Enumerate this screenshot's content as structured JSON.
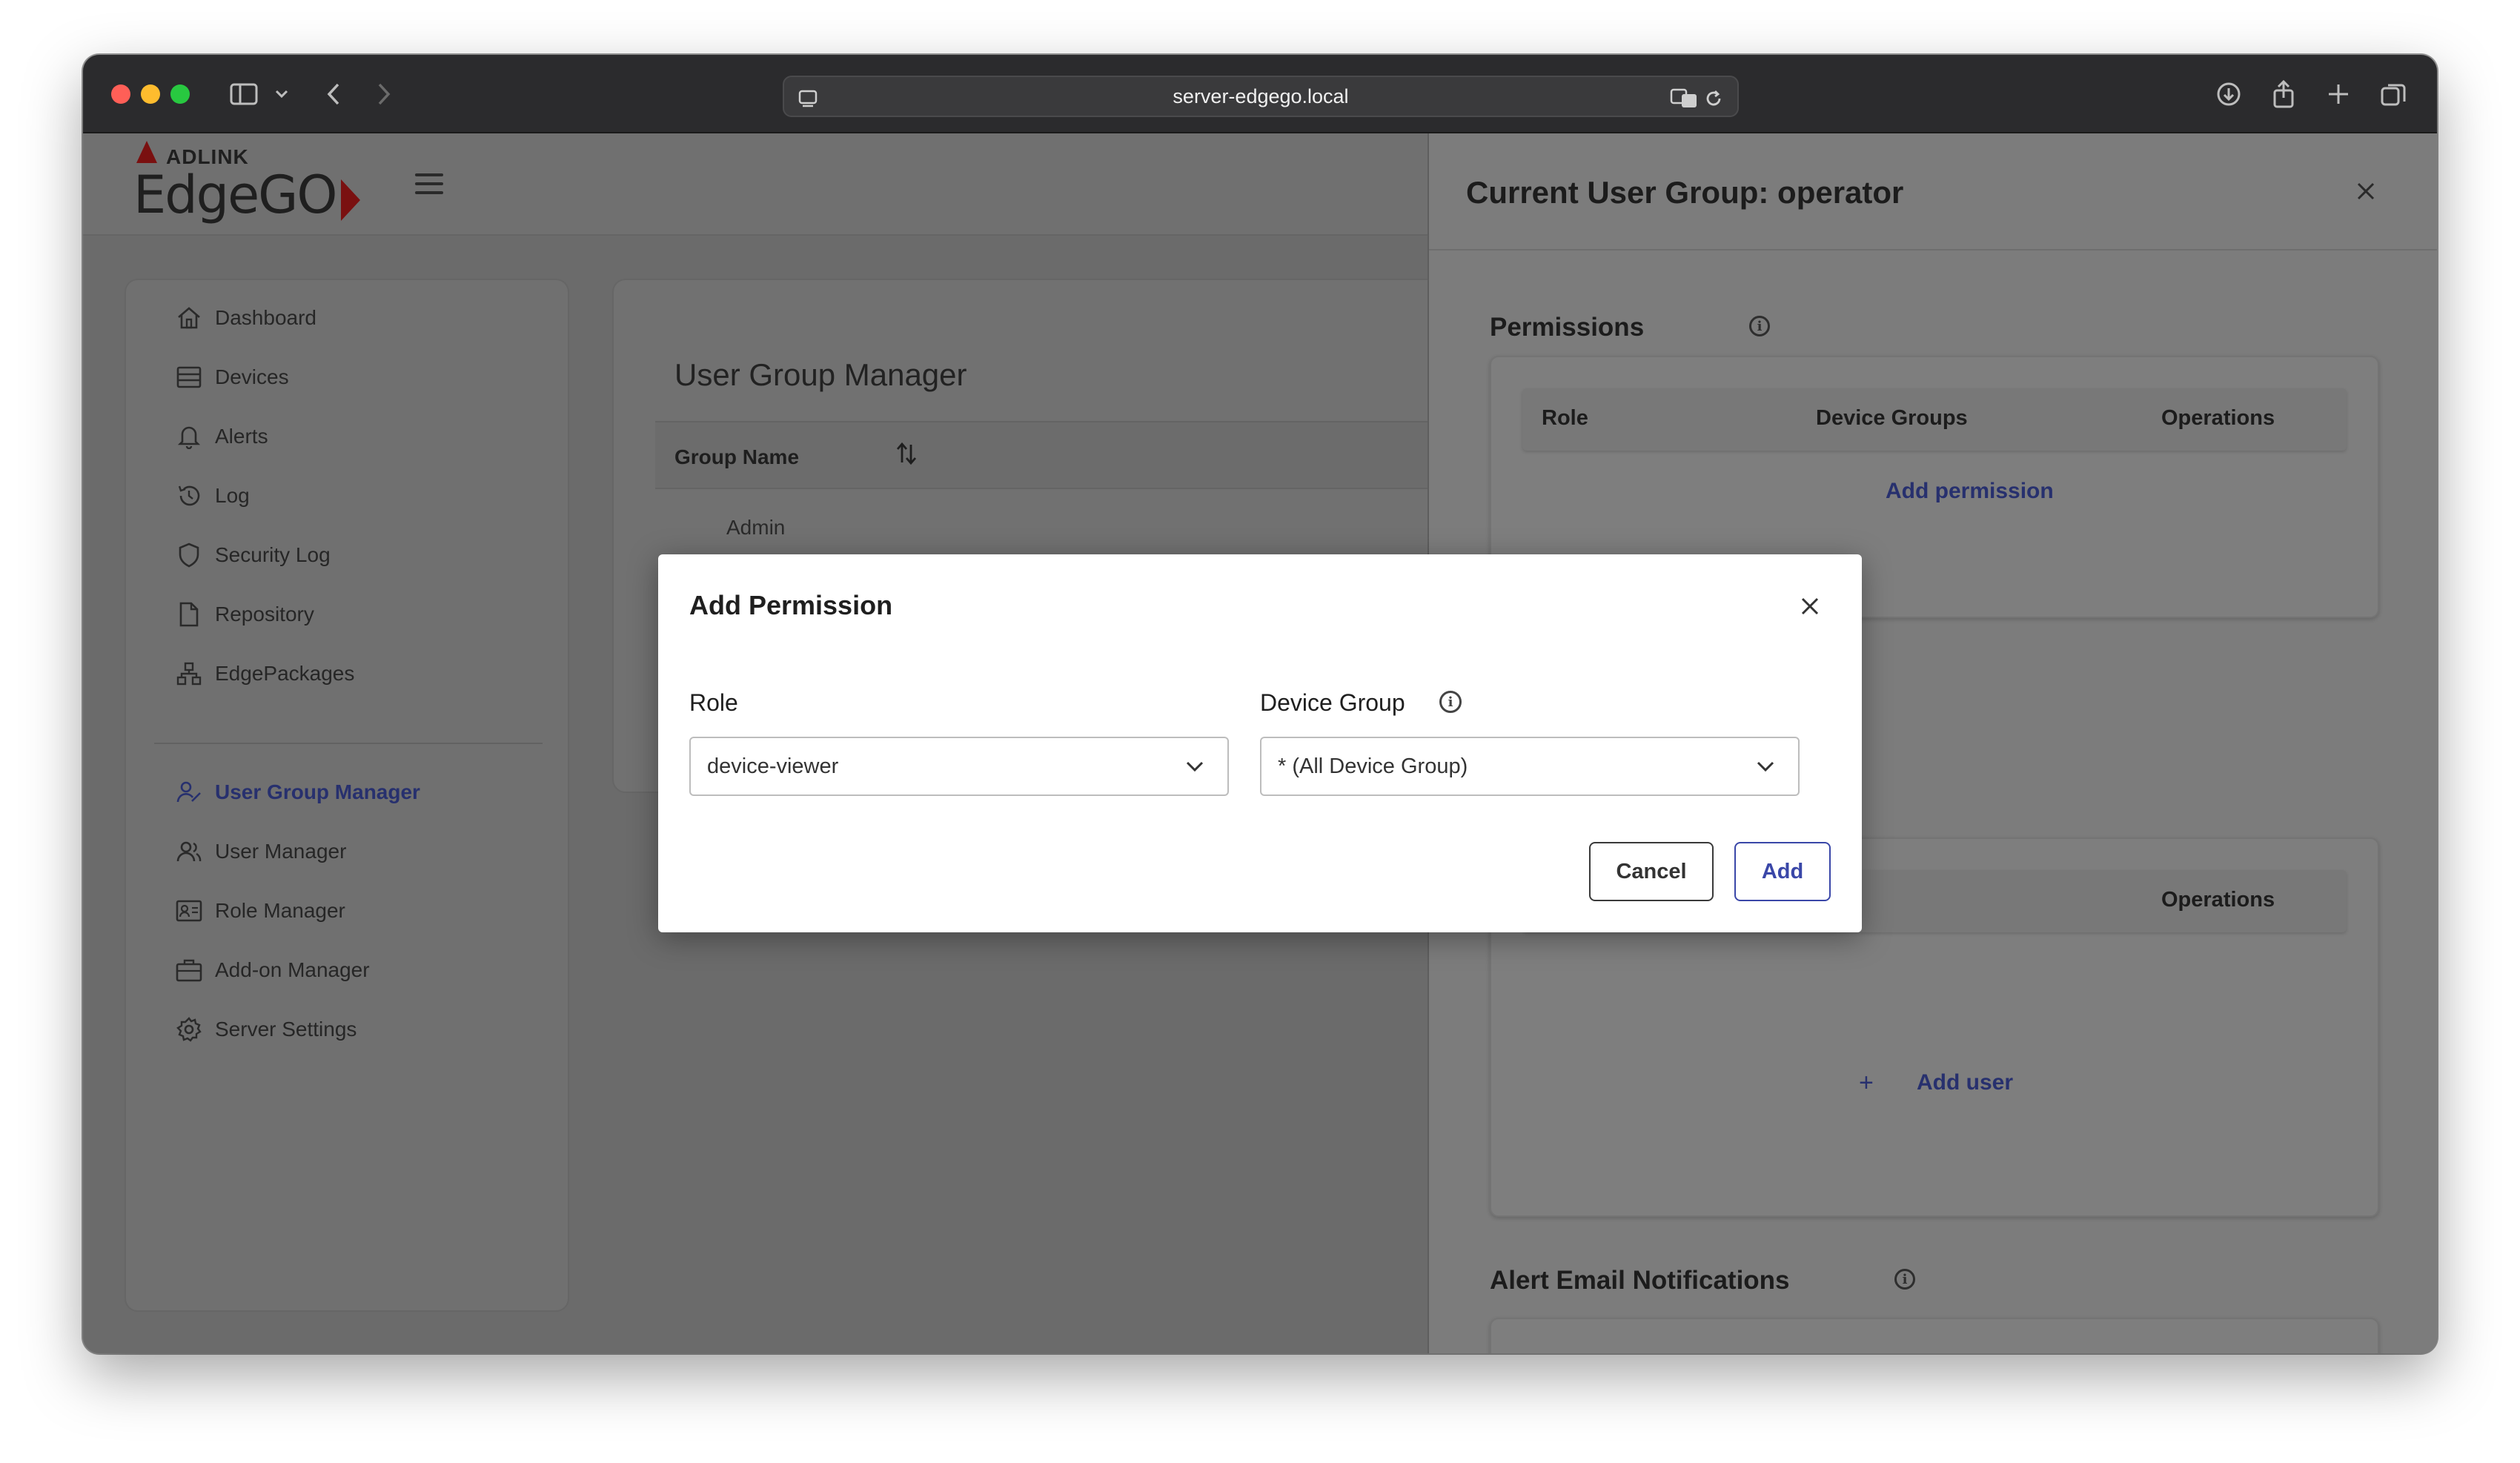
{
  "browser": {
    "address": "server-edgego.local"
  },
  "brand": {
    "company": "ADLINK",
    "product": "EdgeGO"
  },
  "sidebar": {
    "items": [
      {
        "label": "Dashboard",
        "icon": "home-icon"
      },
      {
        "label": "Devices",
        "icon": "devices-icon"
      },
      {
        "label": "Alerts",
        "icon": "bell-icon"
      },
      {
        "label": "Log",
        "icon": "history-icon"
      },
      {
        "label": "Security Log",
        "icon": "shield-icon"
      },
      {
        "label": "Repository",
        "icon": "file-icon"
      },
      {
        "label": "EdgePackages",
        "icon": "packages-icon"
      },
      {
        "label": "User Group Manager",
        "icon": "user-group-icon",
        "active": true
      },
      {
        "label": "User Manager",
        "icon": "users-icon"
      },
      {
        "label": "Role Manager",
        "icon": "id-card-icon"
      },
      {
        "label": "Add-on Manager",
        "icon": "briefcase-icon"
      },
      {
        "label": "Server Settings",
        "icon": "gear-icon"
      }
    ]
  },
  "main": {
    "title": "User Group Manager",
    "column_group_name": "Group Name",
    "rows": [
      "Admin"
    ]
  },
  "drawer": {
    "title": "Current User Group: operator",
    "permissions": {
      "title": "Permissions",
      "columns": [
        "Role",
        "Device Groups",
        "Operations"
      ],
      "add_link": "Add permission"
    },
    "users": {
      "columns": [
        "Operations"
      ],
      "add_link": "Add user"
    },
    "alerts": {
      "title": "Alert Email Notifications"
    }
  },
  "modal": {
    "title": "Add Permission",
    "role_label": "Role",
    "role_value": "device-viewer",
    "device_group_label": "Device Group",
    "device_group_value": "* (All Device Group)",
    "cancel_label": "Cancel",
    "add_label": "Add"
  },
  "colors": {
    "accent": "#3a47a8",
    "link": "#27306e",
    "brand_red": "#7a1010"
  }
}
